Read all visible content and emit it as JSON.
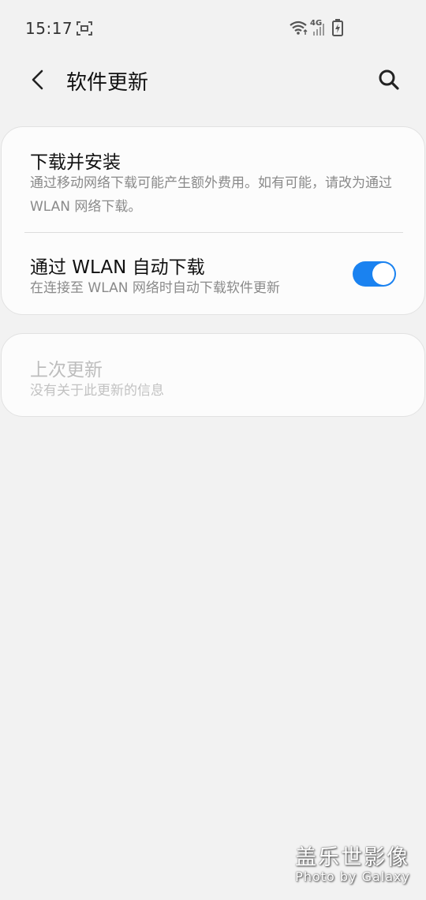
{
  "status_bar": {
    "time": "15:17",
    "network_label": "4G",
    "icons": [
      "screen-recorder-icon",
      "wifi-icon",
      "signal-4g-icon",
      "battery-charging-icon"
    ]
  },
  "app_bar": {
    "title": "软件更新",
    "back_icon": "chevron-left-icon",
    "search_icon": "search-icon"
  },
  "settings": {
    "download_install": {
      "title": "下载并安装",
      "description": "通过移动网络下载可能产生额外费用。如有可能，请改为通过 WLAN 网络下载。"
    },
    "auto_download_wlan": {
      "title": "通过 WLAN 自动下载",
      "description": "在连接至 WLAN 网络时自动下载软件更新",
      "toggle_on": true,
      "accent_color": "#1a82f0"
    }
  },
  "last_update": {
    "title": "上次更新",
    "description": "没有关于此更新的信息"
  },
  "watermark": {
    "title": "盖乐世影像",
    "subtitle": "Photo by Galaxy"
  }
}
